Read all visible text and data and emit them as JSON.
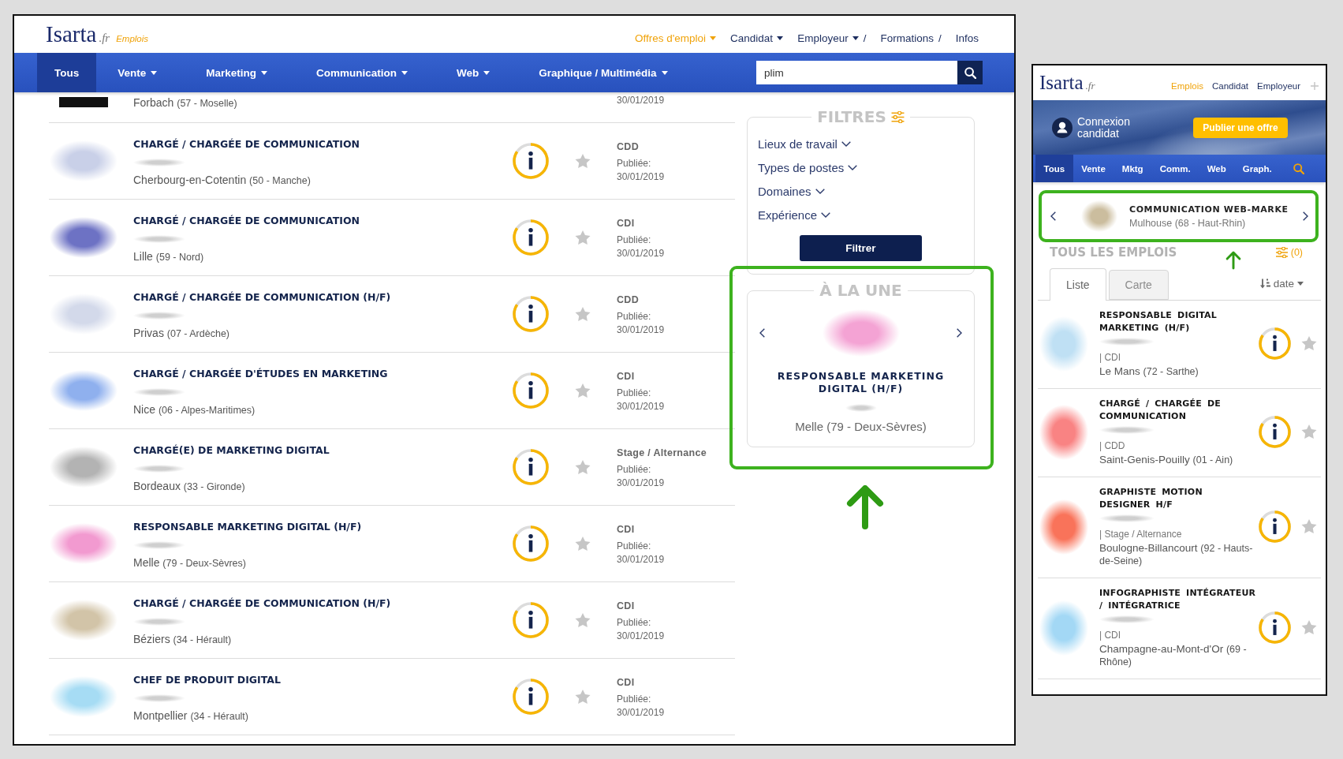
{
  "desktop": {
    "header": {
      "logo": "Isarta",
      "logo_suffix": ".fr",
      "logo_tag": "Emplois",
      "links": [
        {
          "label": "Offres d'emploi",
          "selected": true,
          "dropdown": true
        },
        {
          "label": "Candidat",
          "selected": false,
          "dropdown": true
        },
        {
          "label": "Employeur",
          "selected": false,
          "dropdown": true,
          "separator": "/"
        },
        {
          "label": "Formations",
          "selected": false,
          "dropdown": false,
          "separator": "/"
        },
        {
          "label": "Infos",
          "selected": false,
          "dropdown": false
        }
      ]
    },
    "nav": {
      "tabs": [
        {
          "label": "Tous",
          "selected": true,
          "dropdown": false
        },
        {
          "label": "Vente",
          "selected": false,
          "dropdown": true
        },
        {
          "label": "Marketing",
          "selected": false,
          "dropdown": true
        },
        {
          "label": "Communication",
          "selected": false,
          "dropdown": true
        },
        {
          "label": "Web",
          "selected": false,
          "dropdown": true
        },
        {
          "label": "Graphique / Multimédia",
          "selected": false,
          "dropdown": true
        }
      ],
      "search": {
        "value": "plim"
      }
    },
    "jobs": [
      {
        "kind": "partial",
        "location": "Forbach",
        "department": "(57 - Moselle)",
        "date": "30/01/2019",
        "logo": {
          "kind": "plain",
          "color": "#111111"
        }
      },
      {
        "kind": "full",
        "title": "CHARGÉ / CHARGÉE DE COMMUNICATION",
        "location": "Cherbourg-en-Cotentin",
        "department": "(50 - Manche)",
        "contract": "CDD",
        "published_label": "Publiée:",
        "date": "30/01/2019",
        "starred": false,
        "logo": {
          "kind": "blurred",
          "color": "#c9d0e8"
        }
      },
      {
        "kind": "full",
        "title": "CHARGÉ / CHARGÉE DE COMMUNICATION",
        "location": "Lille",
        "department": "(59 - Nord)",
        "contract": "CDI",
        "published_label": "Publiée:",
        "date": "30/01/2019",
        "starred": false,
        "logo": {
          "kind": "blurred",
          "color": "#6d72c4"
        }
      },
      {
        "kind": "full",
        "title": "CHARGÉ / CHARGÉE DE COMMUNICATION (H/F)",
        "location": "Privas",
        "department": "(07 - Ardèche)",
        "contract": "CDD",
        "published_label": "Publiée:",
        "date": "30/01/2019",
        "starred": false,
        "logo": {
          "kind": "blurred",
          "color": "#d3d9ea"
        }
      },
      {
        "kind": "full",
        "title": "CHARGÉ / CHARGÉE D'ÉTUDES EN MARKETING",
        "location": "Nice",
        "department": "(06 - Alpes-Maritimes)",
        "contract": "CDI",
        "published_label": "Publiée:",
        "date": "30/01/2019",
        "starred": false,
        "logo": {
          "kind": "blurred",
          "color": "#8fb0ee"
        }
      },
      {
        "kind": "full",
        "title": "CHARGÉ(E) DE MARKETING DIGITAL",
        "location": "Bordeaux",
        "department": "(33 - Gironde)",
        "contract": "Stage / Alternance",
        "published_label": "Publiée:",
        "date": "30/01/2019",
        "starred": false,
        "logo": {
          "kind": "blurred",
          "color": "#b3b3b3"
        }
      },
      {
        "kind": "full",
        "title": "RESPONSABLE MARKETING DIGITAL (H/F)",
        "location": "Melle",
        "department": "(79 - Deux-Sèvres)",
        "contract": "CDI",
        "published_label": "Publiée:",
        "date": "30/01/2019",
        "starred": false,
        "logo": {
          "kind": "blurred",
          "color": "#f29ad0"
        }
      },
      {
        "kind": "full",
        "title": "CHARGÉ / CHARGÉE DE COMMUNICATION (H/F)",
        "location": "Béziers",
        "department": "(34 - Hérault)",
        "contract": "CDI",
        "published_label": "Publiée:",
        "date": "30/01/2019",
        "starred": false,
        "logo": {
          "kind": "blurred",
          "color": "#d2c4a8"
        }
      },
      {
        "kind": "full",
        "title": "CHEF DE PRODUIT DIGITAL",
        "location": "Montpellier",
        "department": "(34 - Hérault)",
        "contract": "CDI",
        "published_label": "Publiée:",
        "date": "30/01/2019",
        "starred": false,
        "logo": {
          "kind": "blurred",
          "color": "#a6dcf4"
        }
      }
    ],
    "filters": {
      "title": "FILTRES",
      "items": [
        {
          "label": "Lieux de travail",
          "expanded": false
        },
        {
          "label": "Types de postes",
          "expanded": false
        },
        {
          "label": "Domaines",
          "expanded": false
        },
        {
          "label": "Expérience",
          "expanded": false
        }
      ],
      "button": "Filtrer"
    },
    "featured": {
      "title": "À LA UNE",
      "job": {
        "title": "RESPONSABLE MARKETING DIGITAL (H/F)",
        "location": "Melle (79 - Deux-Sèvres)",
        "logo": {
          "kind": "blurred",
          "color": "#f4a3d4"
        }
      }
    }
  },
  "mobile": {
    "header": {
      "logo": "Isarta",
      "logo_suffix": ".fr",
      "links": [
        {
          "label": "Emplois",
          "selected": true
        },
        {
          "label": "Candidat",
          "selected": false
        },
        {
          "label": "Employeur",
          "selected": false
        }
      ]
    },
    "hero": {
      "login": "Connexion candidat",
      "publish_button": "Publier une offre"
    },
    "nav": {
      "tabs": [
        {
          "label": "Tous",
          "selected": true
        },
        {
          "label": "Vente",
          "selected": false
        },
        {
          "label": "Mktg",
          "selected": false
        },
        {
          "label": "Comm.",
          "selected": false
        },
        {
          "label": "Web",
          "selected": false
        },
        {
          "label": "Graph.",
          "selected": false
        }
      ]
    },
    "featured": {
      "title": "COMMUNICATION WEB-MARKE",
      "location": "Mulhouse (68 - Haut-Rhin)",
      "logo": {
        "kind": "blurred",
        "color": "#cbbd9e"
      }
    },
    "list": {
      "title": "TOUS LES EMPLOIS",
      "filter_count": "(0)",
      "view_tabs": [
        {
          "label": "Liste",
          "selected": true
        },
        {
          "label": "Carte",
          "selected": false
        }
      ],
      "sort": "date"
    },
    "jobs": [
      {
        "title": "RESPONSABLE DIGITAL MARKETING (H/F)",
        "contract": "| CDI",
        "location": "Le Mans",
        "department": "(72 - Sarthe)",
        "starred": false,
        "logo": {
          "kind": "blurred",
          "color": "#bfe0f4"
        }
      },
      {
        "title": "CHARGÉ / CHARGÉE DE COMMUNICATION",
        "contract": "| CDD",
        "location": "Saint-Genis-Pouilly",
        "department": "(01 - Ain)",
        "starred": false,
        "logo": {
          "kind": "blurred",
          "color": "#f98383"
        }
      },
      {
        "title": "GRAPHISTE MOTION DESIGNER H/F",
        "contract": "| Stage / Alternance",
        "location": "Boulogne-Billancourt",
        "department": "(92 - Hauts-de-Seine)",
        "starred": false,
        "logo": {
          "kind": "blurred",
          "color": "#f9735a"
        }
      },
      {
        "title": "INFOGRAPHISTE INTÉGRATEUR / INTÉGRATRICE",
        "contract": "| CDI",
        "location": "Champagne-au-Mont-d'Or",
        "department": "(69 - Rhône)",
        "starred": false,
        "logo": {
          "kind": "blurred",
          "color": "#a3d8f5"
        }
      }
    ]
  }
}
